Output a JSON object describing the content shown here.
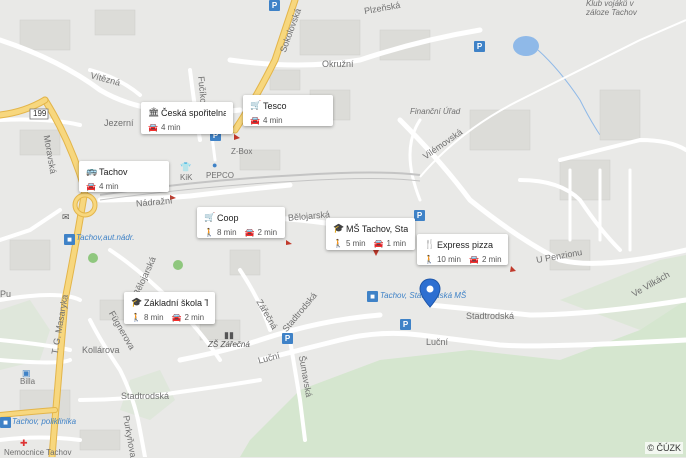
{
  "streets": {
    "plzenska": "Plzeňská",
    "sokolovska": "Sokolovská",
    "okruzni": "Okružní",
    "vitezna": "Vítězná",
    "jezerni": "Jezerní",
    "road_number": "199",
    "moravska": "Moravská",
    "frosova": "Fučíkova",
    "nadrazni": "Nádražní",
    "belojarska": "Bělojarská",
    "vilemovska": "Vilémovská",
    "u_penzionu": "U Penzionu",
    "ve_vilkach": "Ve Vilkách",
    "belojarska2": "Bělojarská",
    "zarecna": "Zářečná",
    "stadtrodska1": "Stadtrodská",
    "stadtrodska2": "Stadtrodská",
    "stadtrodska3": "Stadtrodská",
    "lucni1": "Luční",
    "lucni2": "Luční",
    "sumavska": "Šumavská",
    "fugnerova": "Fügnerova",
    "kollarova": "Kollárova",
    "tg_masaryka": "T. G. Masaryka",
    "purkynova": "Purkyňova",
    "pu": "Pu"
  },
  "places": {
    "klub": "Klub vojáků v\nzáloze Tachov",
    "financni": "Finanční Úřad",
    "zbox": "Z-Box",
    "kik": "KiK",
    "pepco": "PEPCO",
    "bus_station": "Tachov,aut.nádr.",
    "bus_ms": "Tachov, Stadtrodská MŠ",
    "zs": "ZŠ Zářečná",
    "billa": "Billa",
    "poliklinika": "Tachov, poliklinika",
    "nemocnice": "Nemocnice Tachov"
  },
  "cards": [
    {
      "title": "Česká spořitelna",
      "icon": "bank-icon",
      "walk": "",
      "drive": "4 min"
    },
    {
      "title": "Tesco",
      "icon": "cart-icon",
      "walk": "",
      "drive": "4 min"
    },
    {
      "title": "Tachov",
      "icon": "bus-icon",
      "walk": "",
      "drive": "4 min"
    },
    {
      "title": "Coop",
      "icon": "cart-icon",
      "walk": "8 min",
      "drive": "2 min"
    },
    {
      "title": "MŠ Tachov, Stadtr…",
      "icon": "school-icon",
      "walk": "5 min",
      "drive": "1 min"
    },
    {
      "title": "Express pizza",
      "icon": "restaurant-icon",
      "walk": "10 min",
      "drive": "2 min"
    },
    {
      "title": "Základní škola Ta…",
      "icon": "school-icon",
      "walk": "8 min",
      "drive": "2 min"
    }
  ],
  "parking_label": "P",
  "copyright": "© ČÚZK",
  "colors": {
    "background": "#e9e9e7",
    "road": "#ffffff",
    "main_road": "#f7d77e",
    "main_road_edge": "#e3b54a",
    "forest": "#cfe3c8",
    "water": "#8fb9e8",
    "building": "#dcdcd8",
    "accent": "#3f82c7"
  }
}
